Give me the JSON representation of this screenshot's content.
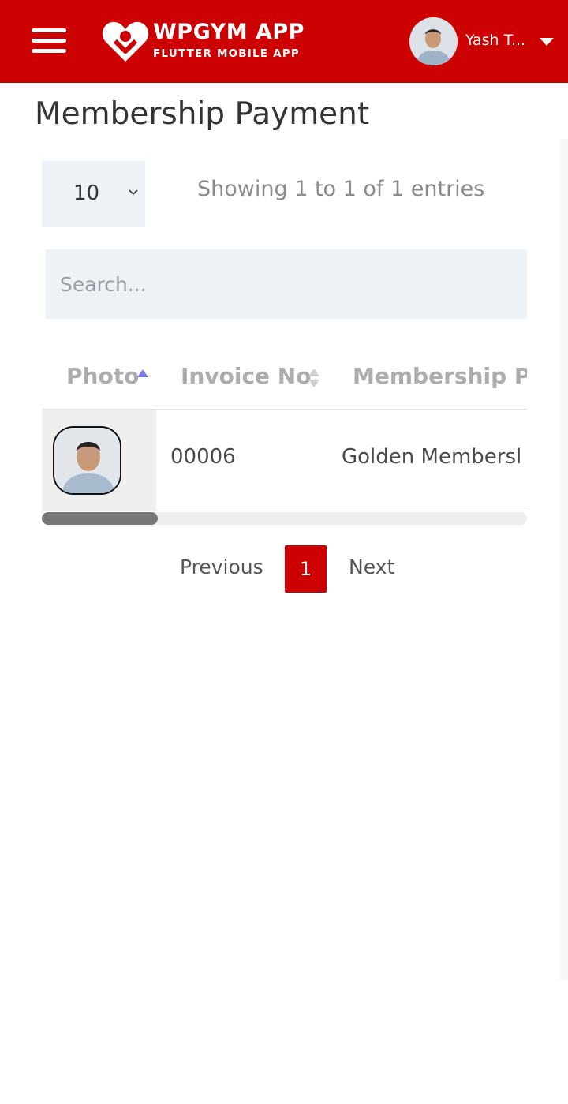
{
  "header": {
    "brand_title": "WPGYM APP",
    "brand_subtitle": "FLUTTER MOBILE APP",
    "user_name": "Yash T...",
    "background_color": "#cc0000",
    "icons": {
      "menu": "hamburger-menu-icon",
      "logo": "heart-logo-icon",
      "dropdown": "caret-down-icon"
    }
  },
  "page": {
    "title": "Membership Payment"
  },
  "table_controls": {
    "page_length": "10",
    "info": "Showing 1 to 1 of 1 entries",
    "search_placeholder": "Search..."
  },
  "table": {
    "columns": [
      "Photo",
      "Invoice No.",
      "Membership Pla"
    ],
    "sort": {
      "Photo": "ascending",
      "Invoice No.": "sortable"
    },
    "rows": [
      {
        "photo": "member-avatar",
        "invoice_no": "00006",
        "membership_plan": "Golden Membersl"
      }
    ],
    "horizontal_scroll_fraction_visible": 0.24
  },
  "pagination": {
    "previous_label": "Previous",
    "current_page": "1",
    "next_label": "Next",
    "accent_color": "#cc0000"
  }
}
